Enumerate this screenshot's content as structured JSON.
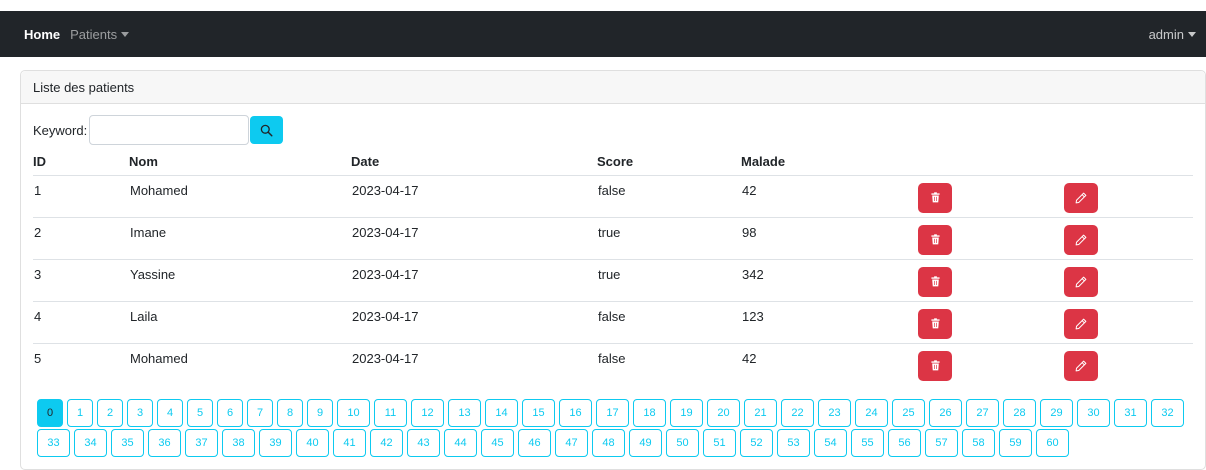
{
  "navbar": {
    "home_label": "Home",
    "patients_label": "Patients",
    "user_label": "admin"
  },
  "card": {
    "header_title": "Liste des patients"
  },
  "search": {
    "keyword_label": "Keyword:",
    "value": "",
    "placeholder": ""
  },
  "table": {
    "headers": [
      "ID",
      "Nom",
      "Date",
      "Score",
      "Malade"
    ],
    "rows": [
      {
        "id": "1",
        "nom": "Mohamed",
        "date": "2023-04-17",
        "score": "false",
        "malade": "42"
      },
      {
        "id": "2",
        "nom": "Imane",
        "date": "2023-04-17",
        "score": "true",
        "malade": "98"
      },
      {
        "id": "3",
        "nom": "Yassine",
        "date": "2023-04-17",
        "score": "true",
        "malade": "342"
      },
      {
        "id": "4",
        "nom": "Laila",
        "date": "2023-04-17",
        "score": "false",
        "malade": "123"
      },
      {
        "id": "5",
        "nom": "Mohamed",
        "date": "2023-04-17",
        "score": "false",
        "malade": "42"
      }
    ]
  },
  "pagination": {
    "current": "0",
    "pages": [
      "0",
      "1",
      "2",
      "3",
      "4",
      "5",
      "6",
      "7",
      "8",
      "9",
      "10",
      "11",
      "12",
      "13",
      "14",
      "15",
      "16",
      "17",
      "18",
      "19",
      "20",
      "21",
      "22",
      "23",
      "24",
      "25",
      "26",
      "27",
      "28",
      "29",
      "30",
      "31",
      "32",
      "33",
      "34",
      "35",
      "36",
      "37",
      "38",
      "39",
      "40",
      "41",
      "42",
      "43",
      "44",
      "45",
      "46",
      "47",
      "48",
      "49",
      "50",
      "51",
      "52",
      "53",
      "54",
      "55",
      "56",
      "57",
      "58",
      "59",
      "60"
    ]
  },
  "colors": {
    "navbar_bg": "#212529",
    "info": "#0dcaf0",
    "danger": "#dc3545"
  },
  "icons": {
    "search": "search-icon",
    "delete": "trash-icon",
    "edit": "pencil-icon",
    "dropdown": "caret-down-icon"
  }
}
